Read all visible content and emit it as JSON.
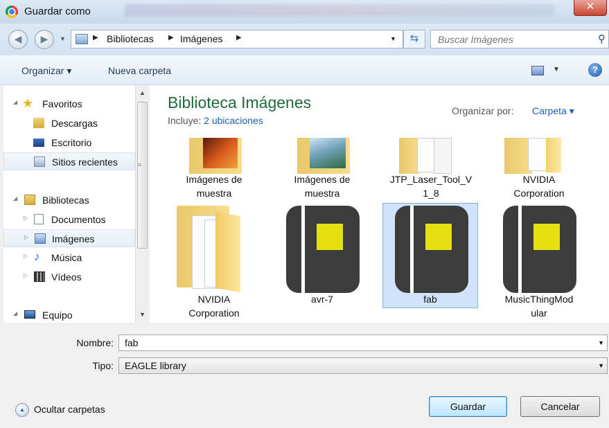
{
  "window": {
    "title": "Guardar como",
    "close_label": "✕"
  },
  "address": {
    "crumbs": [
      "Bibliotecas",
      "Imágenes"
    ],
    "search_placeholder": "Buscar Imágenes"
  },
  "toolbar": {
    "organize_label": "Organizar ▾",
    "new_folder_label": "Nueva carpeta"
  },
  "nav": {
    "items": [
      {
        "label": "Favoritos"
      },
      {
        "label": "Descargas"
      },
      {
        "label": "Escritorio"
      },
      {
        "label": "Sitios recientes"
      },
      {
        "label": "Bibliotecas"
      },
      {
        "label": "Documentos"
      },
      {
        "label": "Imágenes"
      },
      {
        "label": "Música"
      },
      {
        "label": "Vídeos"
      },
      {
        "label": "Equipo"
      }
    ]
  },
  "library": {
    "title": "Biblioteca Imágenes",
    "includes_label": "Incluye:",
    "includes_value": "2 ubicaciones",
    "arrange_label": "Organizar por:",
    "arrange_value": "Carpeta ▾"
  },
  "files": [
    {
      "line1": "Imágenes de",
      "line2": "muestra",
      "icon": "photo-folder-icon"
    },
    {
      "line1": "Imágenes de",
      "line2": "muestra",
      "icon": "photo-folder-icon"
    },
    {
      "line1": "JTP_Laser_Tool_V",
      "line2": "1_8",
      "icon": "folder-icon"
    },
    {
      "line1": "NVIDIA",
      "line2": "Corporation",
      "icon": "folder-icon"
    },
    {
      "line1": "NVIDIA",
      "line2": "Corporation",
      "icon": "folder-icon"
    },
    {
      "line1": "avr-7",
      "line2": "",
      "icon": "eagle-library-icon"
    },
    {
      "line1": "fab",
      "line2": "",
      "icon": "eagle-library-icon",
      "selected": true
    },
    {
      "line1": "MusicThingMod",
      "line2": "ular",
      "icon": "eagle-library-icon"
    }
  ],
  "form": {
    "name_label": "Nombre:",
    "name_value": "fab",
    "type_label": "Tipo:",
    "type_value": "EAGLE library"
  },
  "footer": {
    "hide_folders_label": "Ocultar carpetas",
    "save_label": "Guardar",
    "cancel_label": "Cancelar"
  },
  "colors": {
    "title_green": "#1e6b3a",
    "link_blue": "#1f5fb5",
    "selection": "#cfe4fb",
    "notebook": "#3c3c3c",
    "notebook_label": "#e5e012"
  }
}
